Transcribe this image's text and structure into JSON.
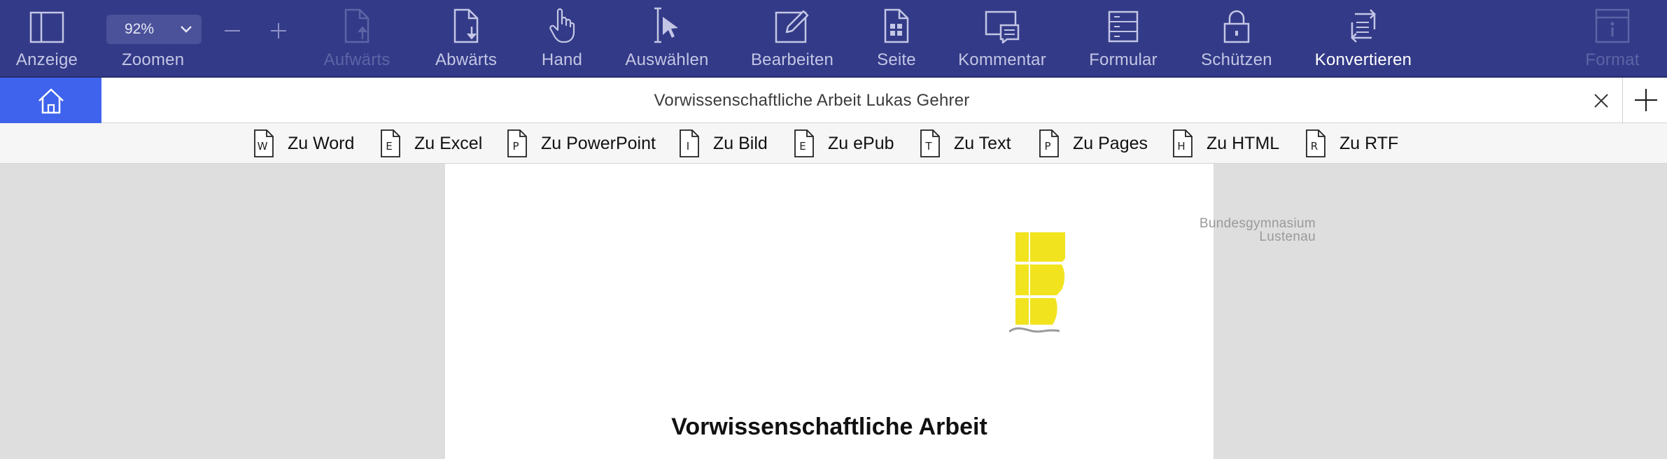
{
  "toolbar": {
    "items": [
      {
        "label": "Anzeige",
        "icon": "sidebar-panel-icon"
      },
      {
        "label": "Zoomen"
      },
      {
        "label": "Aufwärts",
        "icon": "page-up-icon",
        "state": "disabled"
      },
      {
        "label": "Abwärts",
        "icon": "page-down-icon"
      },
      {
        "label": "Hand",
        "icon": "hand-icon"
      },
      {
        "label": "Auswählen",
        "icon": "select-cursor-icon"
      },
      {
        "label": "Bearbeiten",
        "icon": "edit-pencil-icon"
      },
      {
        "label": "Seite",
        "icon": "page-grid-icon"
      },
      {
        "label": "Kommentar",
        "icon": "comment-icon"
      },
      {
        "label": "Formular",
        "icon": "form-icon"
      },
      {
        "label": "Schützen",
        "icon": "lock-icon"
      },
      {
        "label": "Konvertieren",
        "icon": "convert-icon",
        "state": "active"
      },
      {
        "label": "Format",
        "icon": "info-panel-icon",
        "state": "disabled"
      }
    ],
    "zoom": {
      "value": "92%",
      "minus": "−",
      "plus": "+"
    }
  },
  "tab": {
    "title": "Vorwissenschaftliche Arbeit Lukas Gehrer",
    "home_icon": "home-icon",
    "close_icon": "close-icon",
    "new_tab_icon": "plus-icon"
  },
  "convert": {
    "items": [
      {
        "label": "Zu Word",
        "letter": "W"
      },
      {
        "label": "Zu Excel",
        "letter": "E"
      },
      {
        "label": "Zu PowerPoint",
        "letter": "P"
      },
      {
        "label": "Zu Bild",
        "letter": "I"
      },
      {
        "label": "Zu ePub",
        "letter": "E"
      },
      {
        "label": "Zu Text",
        "letter": "T"
      },
      {
        "label": "Zu Pages",
        "letter": "P"
      },
      {
        "label": "Zu HTML",
        "letter": "H"
      },
      {
        "label": "Zu RTF",
        "letter": "R"
      }
    ]
  },
  "document": {
    "school_name_line1": "Bundesgymnasium",
    "school_name_line2": "Lustenau",
    "title": "Vorwissenschaftliche Arbeit"
  },
  "colors": {
    "toolbar_bg": "#333a87",
    "accent_blue": "#3f63ec",
    "logo_yellow": "#f2e31f"
  }
}
